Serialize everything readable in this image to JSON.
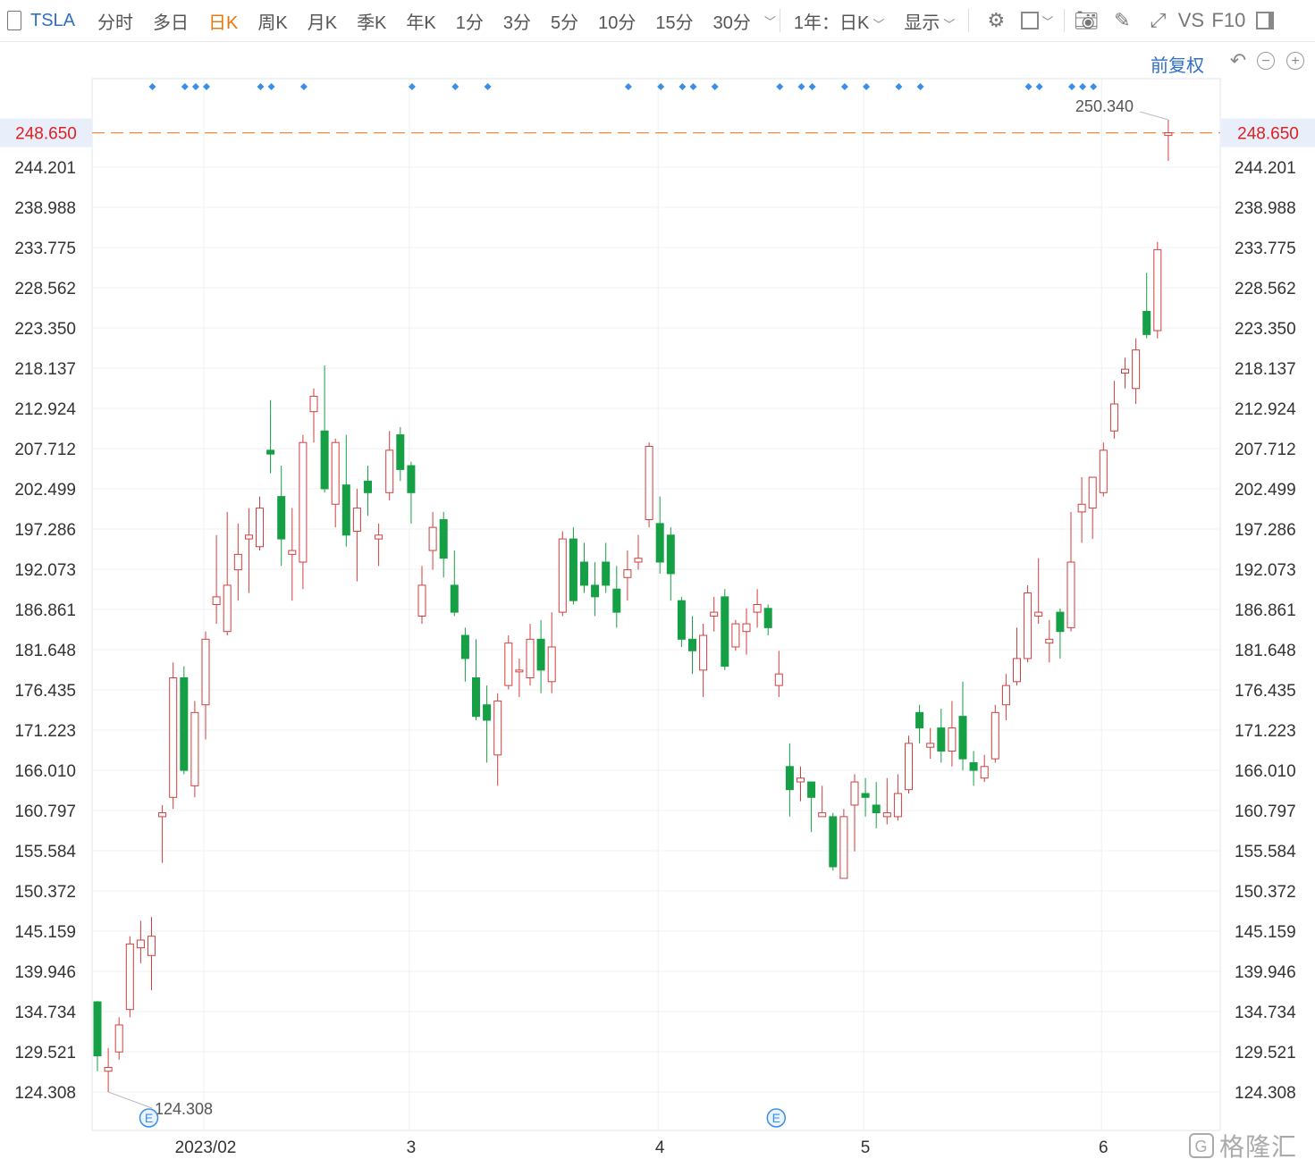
{
  "toolbar": {
    "ticker": "TSLA",
    "periods": [
      {
        "label": "分时",
        "active": false
      },
      {
        "label": "多日",
        "active": false
      },
      {
        "label": "日K",
        "active": true
      },
      {
        "label": "周K",
        "active": false
      },
      {
        "label": "月K",
        "active": false
      },
      {
        "label": "季K",
        "active": false
      },
      {
        "label": "年K",
        "active": false
      },
      {
        "label": "1分",
        "active": false
      },
      {
        "label": "3分",
        "active": false
      },
      {
        "label": "5分",
        "active": false
      },
      {
        "label": "10分",
        "active": false
      },
      {
        "label": "15分",
        "active": false
      },
      {
        "label": "30分",
        "active": false
      }
    ],
    "range_select": "1年：日K",
    "display_select": "显示",
    "vs_label": "VS",
    "f10_label": "F10"
  },
  "adjust_label": "前复权",
  "brand": "格隆汇",
  "colors": {
    "up": "#d23e3e",
    "down": "#16a045",
    "price_line": "#f08a3c",
    "price_label": "#e02020",
    "marker": "#3b8ee6",
    "event": "#3b8ee6"
  },
  "chart_data": {
    "type": "candlestick",
    "title": "",
    "y_ticks": [
      "244.201",
      "238.988",
      "233.775",
      "228.562",
      "223.350",
      "218.137",
      "212.924",
      "207.712",
      "202.499",
      "197.286",
      "192.073",
      "186.861",
      "181.648",
      "176.435",
      "171.223",
      "166.010",
      "160.797",
      "155.584",
      "150.372",
      "145.159",
      "139.946",
      "134.734",
      "129.521",
      "124.308"
    ],
    "ylim": [
      121.0,
      253.0
    ],
    "x_labels": [
      {
        "label": "2023/02",
        "index": 10
      },
      {
        "label": "3",
        "index": 29
      },
      {
        "label": "4",
        "index": 52
      },
      {
        "label": "5",
        "index": 71
      },
      {
        "label": "6",
        "index": 93
      }
    ],
    "current_price": "248.650",
    "max_label": "250.340",
    "min_label": "124.308",
    "max_index": 99,
    "min_index": 1,
    "event_markers": [
      {
        "index": 5,
        "label": "E"
      },
      {
        "index": 63,
        "label": "E"
      }
    ],
    "marker_indices": [
      5,
      8,
      9,
      10,
      15,
      16,
      19,
      29,
      33,
      36,
      49,
      52,
      54,
      55,
      57,
      63,
      65,
      66,
      69,
      71,
      74,
      76,
      86,
      87,
      90,
      91,
      92
    ],
    "candles": [
      [
        136.0,
        129.0,
        136.1,
        127.0
      ],
      [
        127.0,
        127.5,
        130.0,
        124.3
      ],
      [
        129.5,
        133.0,
        134.0,
        128.5
      ],
      [
        135.0,
        143.5,
        144.5,
        134.0
      ],
      [
        143.0,
        144.0,
        146.5,
        141.0
      ],
      [
        142.0,
        144.5,
        147.0,
        137.5
      ],
      [
        160.0,
        160.5,
        161.5,
        154.0
      ],
      [
        162.5,
        178.0,
        180.0,
        161.0
      ],
      [
        178.0,
        166.0,
        179.5,
        165.5
      ],
      [
        164.0,
        173.5,
        175.0,
        162.5
      ],
      [
        174.5,
        183.0,
        184.0,
        170.0
      ],
      [
        187.5,
        188.5,
        196.5,
        185.0
      ],
      [
        184.0,
        190.0,
        199.5,
        183.5
      ],
      [
        192.0,
        194.0,
        198.0,
        188.0
      ],
      [
        196.0,
        196.5,
        200.0,
        189.0
      ],
      [
        195.0,
        200.0,
        201.5,
        194.5
      ],
      [
        207.5,
        207.0,
        214.0,
        204.5
      ],
      [
        201.5,
        196.0,
        205.5,
        192.5
      ],
      [
        194.0,
        194.5,
        200.0,
        188.0
      ],
      [
        193.0,
        208.5,
        209.5,
        189.5
      ],
      [
        212.5,
        214.5,
        215.5,
        208.5
      ],
      [
        210.0,
        202.5,
        218.5,
        202.0
      ],
      [
        200.5,
        208.5,
        209.0,
        197.5
      ],
      [
        203.0,
        196.5,
        209.5,
        195.0
      ],
      [
        197.0,
        200.0,
        202.5,
        190.5
      ],
      [
        203.5,
        202.0,
        205.5,
        199.0
      ],
      [
        196.0,
        196.5,
        198.0,
        192.5
      ],
      [
        202.0,
        207.5,
        210.0,
        201.0
      ],
      [
        209.5,
        205.0,
        210.5,
        203.5
      ],
      [
        205.5,
        202.0,
        206.0,
        198.0
      ],
      [
        186.0,
        190.0,
        192.5,
        185.0
      ],
      [
        194.5,
        197.5,
        199.5,
        192.0
      ],
      [
        198.5,
        193.5,
        199.5,
        191.0
      ],
      [
        190.0,
        186.5,
        194.5,
        186.0
      ],
      [
        183.5,
        180.5,
        184.5,
        177.5
      ],
      [
        178.0,
        173.0,
        183.0,
        172.5
      ],
      [
        174.5,
        172.5,
        177.0,
        167.0
      ],
      [
        168.0,
        175.0,
        176.0,
        164.0
      ],
      [
        177.0,
        182.5,
        183.5,
        176.5
      ],
      [
        179.0,
        179.0,
        180.5,
        175.5
      ],
      [
        178.0,
        183.0,
        185.0,
        177.0
      ],
      [
        183.0,
        179.0,
        185.5,
        176.0
      ],
      [
        177.5,
        182.0,
        186.5,
        176.0
      ],
      [
        186.5,
        196.0,
        197.0,
        186.0
      ],
      [
        196.0,
        188.0,
        197.5,
        187.5
      ],
      [
        193.0,
        190.0,
        195.5,
        189.0
      ],
      [
        190.0,
        188.5,
        193.0,
        186.0
      ],
      [
        193.0,
        190.0,
        195.5,
        189.0
      ],
      [
        189.5,
        186.5,
        192.5,
        184.5
      ],
      [
        191.0,
        192.0,
        194.5,
        188.0
      ],
      [
        193.0,
        193.5,
        196.5,
        192.0
      ],
      [
        198.5,
        208.0,
        208.5,
        197.5
      ],
      [
        198.0,
        193.0,
        201.5,
        191.5
      ],
      [
        196.5,
        191.5,
        197.5,
        188.0
      ],
      [
        188.0,
        183.0,
        188.5,
        182.0
      ],
      [
        183.0,
        181.5,
        186.0,
        178.5
      ],
      [
        179.0,
        183.5,
        185.0,
        175.5
      ],
      [
        186.0,
        186.5,
        188.5,
        184.0
      ],
      [
        188.5,
        179.5,
        189.5,
        179.0
      ],
      [
        182.0,
        185.0,
        185.5,
        181.5
      ],
      [
        184.0,
        185.0,
        187.0,
        181.0
      ],
      [
        186.5,
        187.5,
        189.5,
        184.5
      ],
      [
        187.0,
        184.5,
        187.5,
        183.5
      ],
      [
        177.0,
        178.5,
        181.5,
        175.5
      ],
      [
        166.5,
        163.5,
        169.5,
        160.0
      ],
      [
        164.5,
        165.0,
        166.5,
        162.0
      ],
      [
        164.5,
        162.5,
        164.5,
        158.0
      ],
      [
        160.0,
        160.5,
        164.0,
        160.0
      ],
      [
        160.0,
        153.5,
        160.5,
        153.0
      ],
      [
        152.0,
        160.0,
        161.0,
        152.0
      ],
      [
        161.5,
        164.5,
        165.5,
        155.5
      ],
      [
        163.0,
        162.5,
        165.0,
        160.0
      ],
      [
        161.5,
        160.5,
        164.5,
        158.5
      ],
      [
        160.0,
        160.5,
        165.0,
        159.0
      ],
      [
        160.0,
        163.0,
        165.5,
        159.5
      ],
      [
        163.5,
        169.5,
        170.5,
        163.0
      ],
      [
        173.5,
        171.5,
        174.5,
        169.5
      ],
      [
        169.0,
        169.5,
        171.5,
        167.5
      ],
      [
        171.5,
        168.5,
        174.0,
        167.0
      ],
      [
        168.5,
        171.5,
        175.0,
        166.5
      ],
      [
        173.0,
        167.5,
        177.5,
        166.0
      ],
      [
        167.0,
        166.0,
        168.5,
        164.0
      ],
      [
        165.0,
        166.5,
        168.0,
        164.5
      ],
      [
        167.5,
        173.5,
        174.5,
        167.0
      ],
      [
        174.5,
        177.0,
        178.5,
        172.5
      ],
      [
        177.5,
        180.5,
        184.5,
        177.0
      ],
      [
        180.5,
        189.0,
        190.0,
        180.0
      ],
      [
        186.0,
        186.5,
        193.5,
        185.0
      ],
      [
        182.5,
        183.0,
        185.5,
        180.0
      ],
      [
        186.5,
        184.0,
        187.0,
        180.5
      ],
      [
        184.5,
        193.0,
        199.5,
        184.0
      ],
      [
        199.5,
        200.5,
        204.0,
        195.5
      ],
      [
        200.0,
        204.0,
        203.5,
        196.0
      ],
      [
        202.0,
        207.5,
        208.5,
        201.5
      ],
      [
        210.0,
        213.5,
        216.5,
        209.0
      ],
      [
        217.5,
        218.0,
        219.5,
        215.5
      ],
      [
        215.5,
        220.5,
        222.0,
        213.5
      ],
      [
        225.5,
        222.5,
        230.5,
        222.0
      ],
      [
        223.0,
        233.5,
        234.5,
        222.0
      ],
      [
        248.3,
        248.65,
        250.34,
        245.0
      ]
    ]
  }
}
